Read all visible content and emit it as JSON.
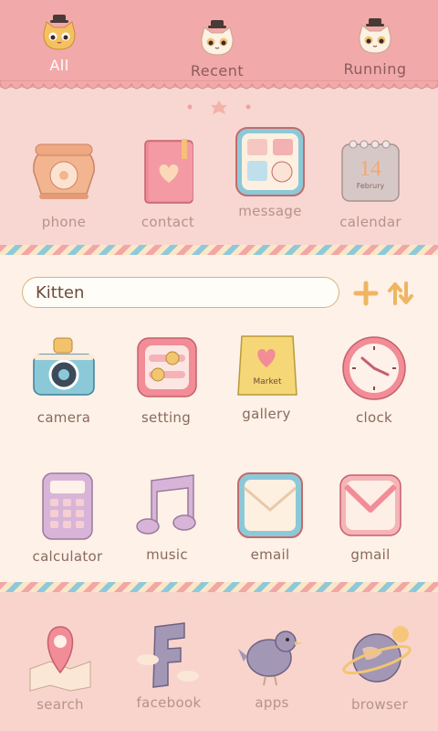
{
  "tabs": [
    {
      "label": "All"
    },
    {
      "label": "Recent"
    },
    {
      "label": "Running"
    }
  ],
  "top_row": [
    {
      "label": "phone",
      "icon": "phone-icon"
    },
    {
      "label": "contact",
      "icon": "contact-book-icon"
    },
    {
      "label": "message",
      "icon": "message-icon"
    },
    {
      "label": "calendar",
      "icon": "calendar-icon",
      "calendar_number": "14",
      "calendar_month": "Februry"
    }
  ],
  "search": {
    "value": "Kitten"
  },
  "grid": [
    {
      "label": "camera",
      "icon": "camera-icon"
    },
    {
      "label": "setting",
      "icon": "setting-icon"
    },
    {
      "label": "gallery",
      "icon": "gallery-icon",
      "bag_text": "Market"
    },
    {
      "label": "clock",
      "icon": "clock-icon"
    },
    {
      "label": "calculator",
      "icon": "calculator-icon"
    },
    {
      "label": "music",
      "icon": "music-icon"
    },
    {
      "label": "email",
      "icon": "email-icon"
    },
    {
      "label": "gmail",
      "icon": "gmail-icon"
    }
  ],
  "dock": [
    {
      "label": "search",
      "icon": "map-pin-icon"
    },
    {
      "label": "facebook",
      "icon": "facebook-icon"
    },
    {
      "label": "apps",
      "icon": "bird-icon"
    },
    {
      "label": "browser",
      "icon": "planet-icon"
    }
  ],
  "colors": {
    "header": "#f2a9a9",
    "panel": "#fdf1e8",
    "dock": "#f8d4cd",
    "stripe_blue": "#8fc9d9"
  }
}
